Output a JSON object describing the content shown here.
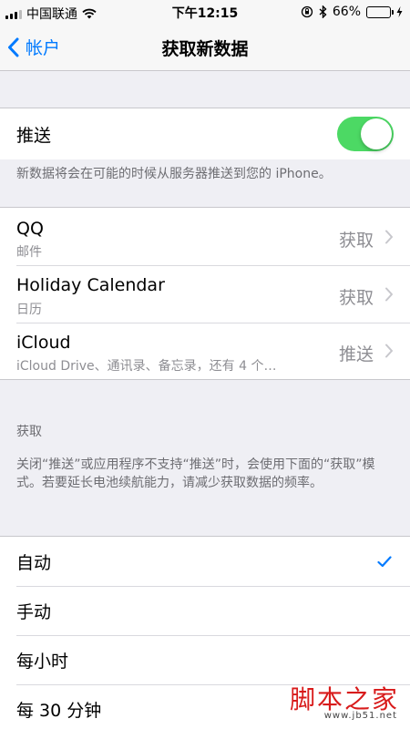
{
  "status_bar": {
    "carrier": "中国联通",
    "time": "下午12:15",
    "battery_percent": "66%",
    "battery_level": 0.66,
    "wifi_icon": "wifi-icon",
    "bluetooth_icon": "bluetooth-icon",
    "lock_icon": "orientation-lock-icon",
    "charging_icon": "charging-bolt-icon"
  },
  "nav": {
    "back_label": "帐户",
    "title": "获取新数据"
  },
  "push": {
    "label": "推送",
    "enabled": true,
    "footnote": "新数据将会在可能的时候从服务器推送到您的 iPhone。"
  },
  "accounts": [
    {
      "title": "QQ",
      "subtitle": "邮件",
      "value": "获取"
    },
    {
      "title": "Holiday Calendar",
      "subtitle": "日历",
      "value": "获取"
    },
    {
      "title": "iCloud",
      "subtitle": "iCloud Drive、通讯录、备忘录，还有 4 个…",
      "value": "推送"
    }
  ],
  "fetch": {
    "header": "获取",
    "description": "关闭“推送”或应用程序不支持“推送”时，会使用下面的“获取”模式。若要延长电池续航能力，请减少获取数据的频率。",
    "options": [
      {
        "label": "自动",
        "selected": true
      },
      {
        "label": "手动",
        "selected": false
      },
      {
        "label": "每小时",
        "selected": false
      },
      {
        "label": "每 30 分钟",
        "selected": false
      }
    ]
  },
  "colors": {
    "accent": "#007aff",
    "toggle_on": "#4cd964",
    "background": "#efeff4"
  },
  "watermark": {
    "text": "脚本之家",
    "url": "www.jb51.net"
  }
}
